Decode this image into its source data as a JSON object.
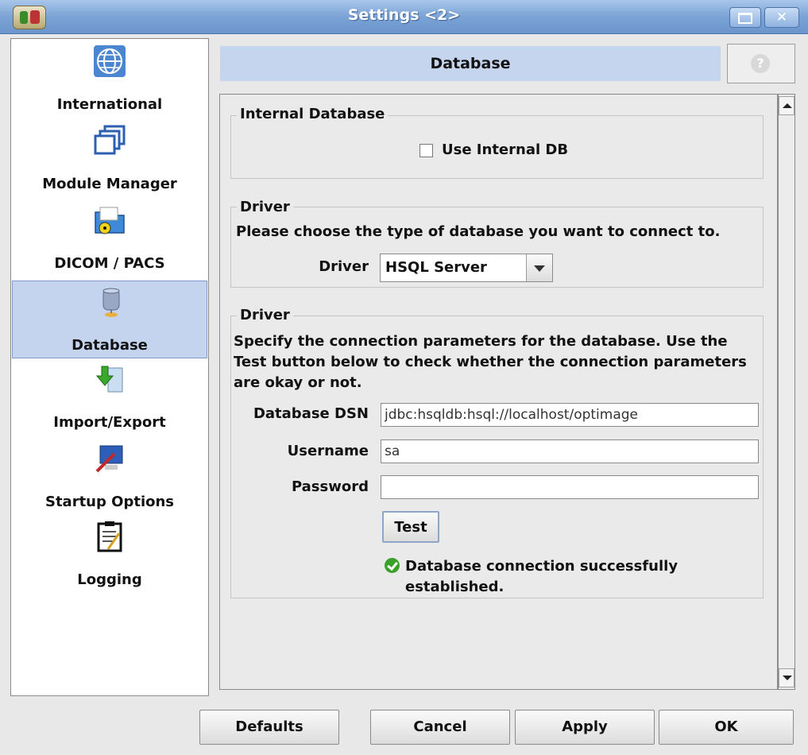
{
  "window": {
    "title": "Settings <2>"
  },
  "sidebar": {
    "items": [
      {
        "label": "International",
        "icon": "globe-icon"
      },
      {
        "label": "Module Manager",
        "icon": "windows-icon"
      },
      {
        "label": "DICOM / PACS",
        "icon": "folder-radiation-icon"
      },
      {
        "label": "Database",
        "icon": "database-icon",
        "selected": true
      },
      {
        "label": "Import/Export",
        "icon": "import-export-icon"
      },
      {
        "label": "Startup Options",
        "icon": "monitor-icon"
      },
      {
        "label": "Logging",
        "icon": "clipboard-icon"
      }
    ]
  },
  "header": {
    "title": "Database",
    "help_label": "?"
  },
  "internal_db": {
    "group_title": "Internal Database",
    "checkbox_label": "Use Internal DB",
    "checked": false
  },
  "driver_select": {
    "group_title": "Driver",
    "description": "Please choose the type of database you want to connect to.",
    "label": "Driver",
    "value": "HSQL Server"
  },
  "connection": {
    "group_title": "Driver",
    "description": "Specify the connection parameters for the database. Use the Test button below to check whether the connection parameters are okay or not.",
    "dsn_label": "Database DSN",
    "dsn_value": "jdbc:hsqldb:hsql://localhost/optimage",
    "username_label": "Username",
    "username_value": "sa",
    "password_label": "Password",
    "password_value": "",
    "test_label": "Test",
    "status": "Database connection successfully established."
  },
  "footer": {
    "defaults_label": "Defaults",
    "cancel_label": "Cancel",
    "apply_label": "Apply",
    "ok_label": "OK"
  }
}
